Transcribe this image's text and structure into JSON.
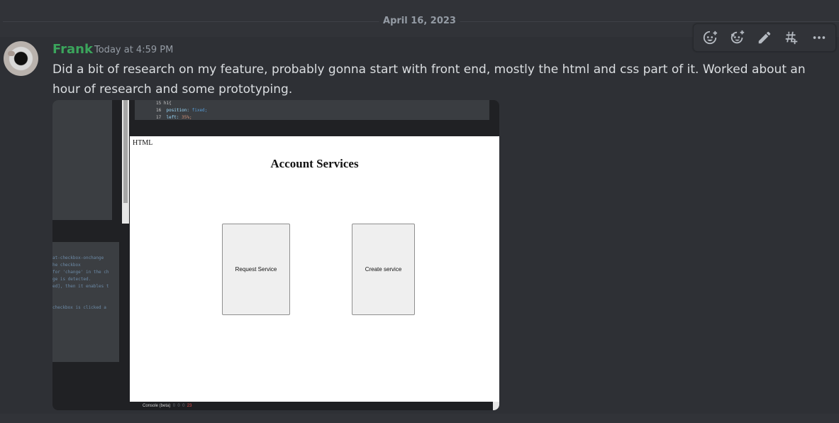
{
  "date_divider": "April 16, 2023",
  "message": {
    "author": "Frank",
    "timestamp": "Today at 4:59 PM",
    "content": "Did a bit of research on my feature, probably gonna start with front end, mostly the html and css part of it. Worked about an hour of research and some prototyping.",
    "author_color": "#3ba55c"
  },
  "toolbar": {
    "icons": [
      "add-reaction-icon",
      "super-reaction-icon",
      "edit-icon",
      "create-thread-icon",
      "more-icon"
    ]
  },
  "attachment": {
    "code_lines": [
      {
        "num": "15",
        "text": "h1{"
      },
      {
        "num": "16",
        "key": "position:",
        "val": "fixed;"
      },
      {
        "num": "17",
        "key": "left:",
        "val": "35%;"
      },
      {
        "num": "18",
        "text": "}"
      }
    ],
    "side_code": [
      "at-checkbox-onchange",
      "he checkbox",
      "for 'change' in the ch",
      "ge is detected.",
      "ed], then it enables t",
      "",
      "",
      "checkbox is clicked a"
    ],
    "preview_label": "HTML",
    "preview_title": "Account Services",
    "button_request": "Request Service",
    "button_create": "Create service",
    "console_label": "Console (beta)",
    "console_counts": [
      "0",
      "0",
      "0",
      "23"
    ]
  }
}
